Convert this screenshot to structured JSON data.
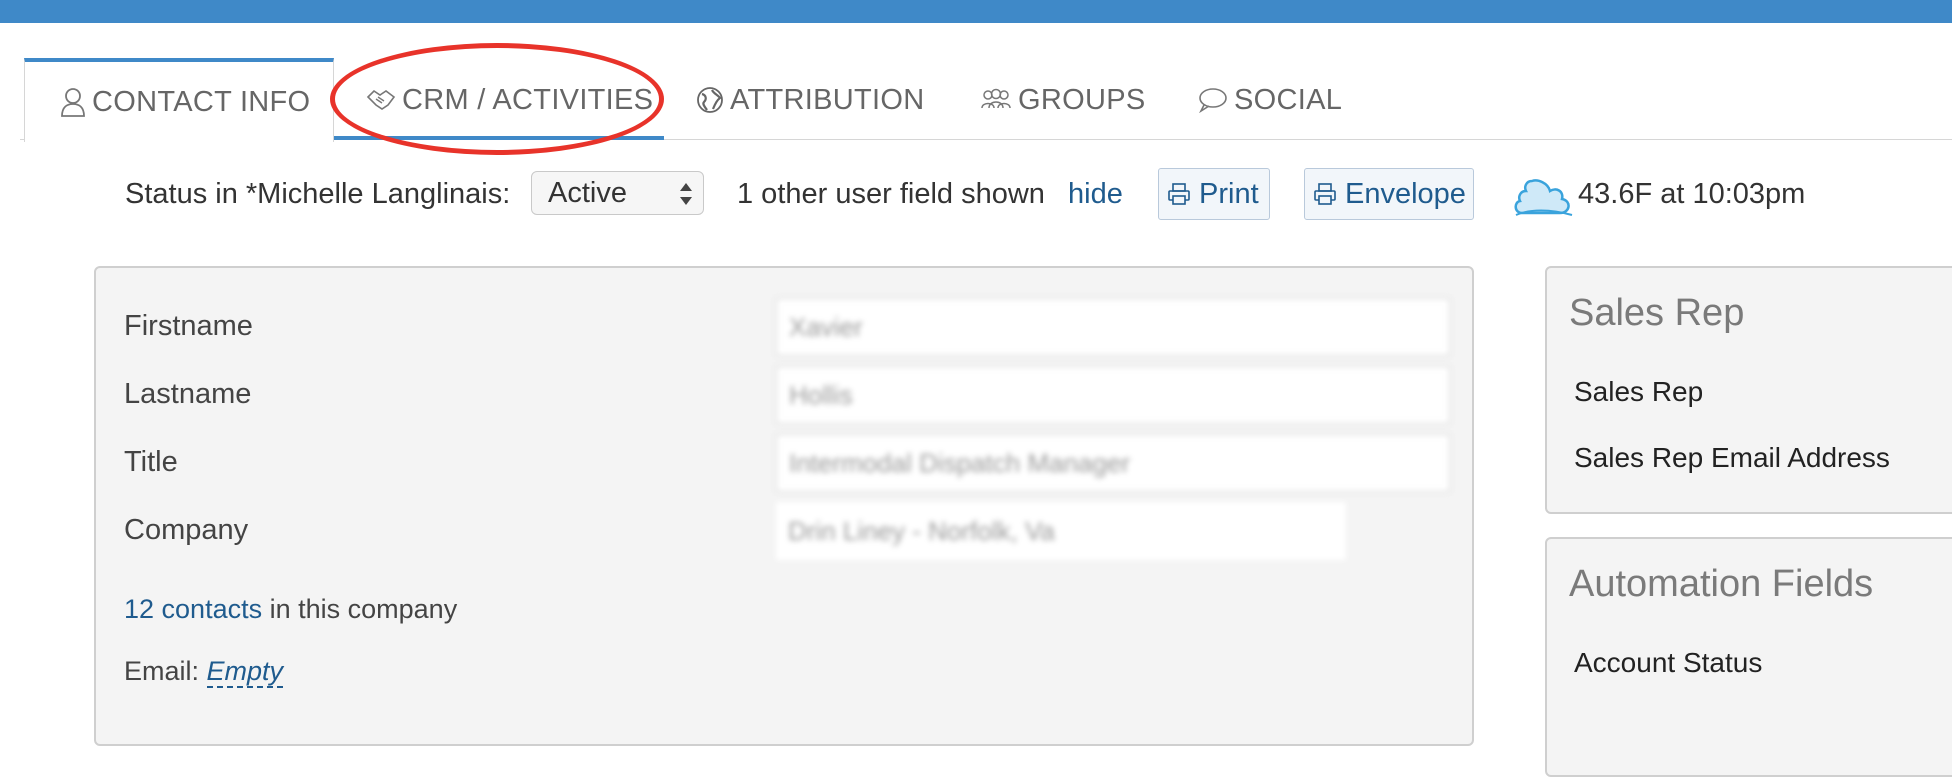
{
  "tabs": [
    {
      "label": "CONTACT INFO",
      "icon": "user-icon",
      "active": true
    },
    {
      "label": "CRM / ACTIVITIES",
      "icon": "handshake-icon",
      "active": false
    },
    {
      "label": "ATTRIBUTION",
      "icon": "globe-icon",
      "active": false
    },
    {
      "label": "GROUPS",
      "icon": "group-icon",
      "active": false
    },
    {
      "label": "SOCIAL",
      "icon": "speech-bubble-icon",
      "active": false
    }
  ],
  "status": {
    "label": "Status in *Michelle Langlinais:",
    "selected": "Active",
    "fields_shown": "1 other user field shown",
    "hide_link": "hide",
    "print_label": "Print",
    "envelope_label": "Envelope",
    "weather_temp": "43.6F",
    "weather_time": "at 10:03pm"
  },
  "contact": {
    "fields": [
      {
        "label": "Firstname",
        "value": "Xavier"
      },
      {
        "label": "Lastname",
        "value": "Hollis"
      },
      {
        "label": "Title",
        "value": "Intermodal Dispatch Manager"
      },
      {
        "label": "Company",
        "value": "Drin Lineу - Norfolk, Va"
      }
    ],
    "contacts_link": "12 contacts",
    "contacts_suffix": "in this company",
    "email_label": "Email:",
    "email_value": "Empty"
  },
  "sales_rep": {
    "title": "Sales Rep",
    "items": [
      "Sales Rep",
      "Sales Rep Email Address"
    ]
  },
  "automation": {
    "title": "Automation Fields",
    "items": [
      "Account Status"
    ]
  },
  "colors": {
    "brand_blue": "#3f89c8",
    "link_blue": "#1f5b8e",
    "highlight_red": "#e8332a"
  }
}
